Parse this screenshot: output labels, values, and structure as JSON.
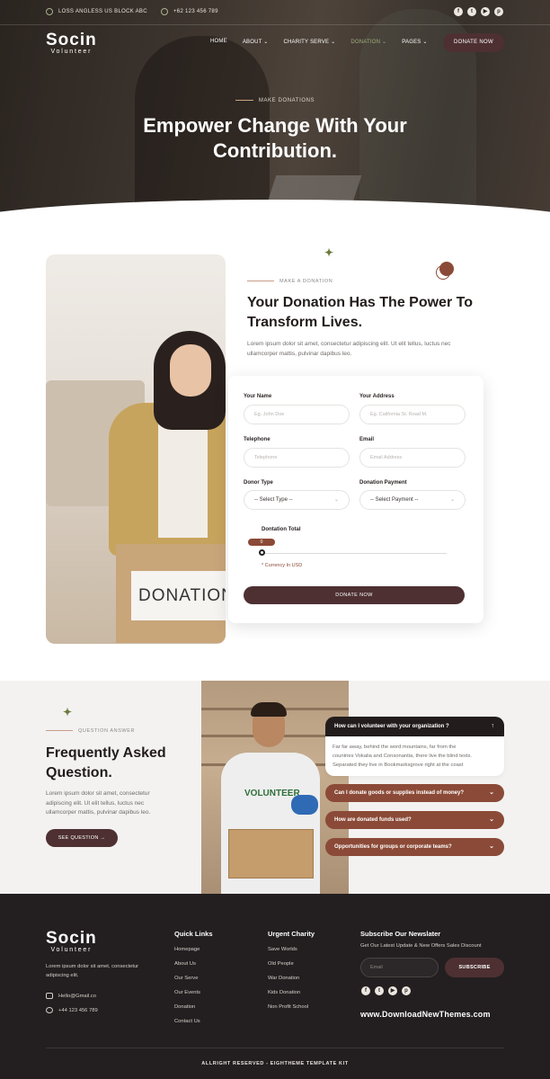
{
  "topbar": {
    "address": "LOSS ANGLESS US BLOCK ABC",
    "phone": "+62 123 456 789",
    "socials": [
      "facebook-icon",
      "twitter-icon",
      "youtube-icon",
      "pinterest-icon"
    ]
  },
  "brand": {
    "name": "Socin",
    "tagline": "Volunteer"
  },
  "nav": {
    "items": [
      "HOME",
      "ABOUT",
      "CHARITY SERVE",
      "DONATION",
      "PAGES"
    ],
    "active": "DONATION",
    "cta": "DONATE NOW"
  },
  "hero": {
    "eyebrow": "MAKE DONATIONS",
    "title_line1": "Empower Change With Your",
    "title_line2": "Contribution."
  },
  "donation": {
    "eyebrow": "MAKE A DONATION",
    "title_line1": "Your Donation Has The Power To",
    "title_line2": "Transform Lives.",
    "text_line1": "Lorem ipsum dolor sit amet, consectetur adipiscing elit. Ut elit tellus, luctus nec",
    "text_line2": "ullamcorper mattis, pulvinar dapibus leo.",
    "photo_label": "DONATION"
  },
  "form": {
    "name_label": "Your Name",
    "name_placeholder": "Eg. John Doe",
    "address_label": "Your Address",
    "address_placeholder": "Eg. California St. Road M.",
    "phone_label": "Telephone",
    "phone_placeholder": "Telephone",
    "email_label": "Email",
    "email_placeholder": "Email Address",
    "donor_label": "Donor Type",
    "donor_value": "-- Select Type --",
    "payment_label": "Donation Payment",
    "payment_value": "-- Select Payment --",
    "total_label": "Dontation Total",
    "total_value": "0",
    "currency": "* Currency In USD",
    "submit": "DONATE NOW"
  },
  "faq": {
    "eyebrow": "QUESTION ANSWER",
    "title_line1": "Frequently Asked",
    "title_line2": "Question.",
    "text_line1": "Lorem ipsum dolor sit amet, consectetur",
    "text_line2": "adipiscing elit. Ut elit tellus, luctus nec",
    "text_line3": "ullamcorper mattis, pulvinar dapibus leo.",
    "button": "SEE QUESTION",
    "photo_shirt": "VOLUNTEER",
    "open_question": "How can I volunteer with your organization ?",
    "open_answer_line1": "Far far away, behind the word mountains, far from the",
    "open_answer_line2": "countries Vokalia and Consonantia, there live the blind texts.",
    "open_answer_line3": "Separated they live in Bookmarksgrove right at the coast",
    "q2": "Can I donate goods or supplies instead of money?",
    "q3": "How are donated funds used?",
    "q4": "Opportunities for groups or corporate teams?",
    "colors": {
      "open": "#221c1d",
      "closed": "#8b4a37"
    }
  },
  "footer": {
    "about_line1": "Lorem ipsum dolor sit amet, consectetur",
    "about_line2": "adipiscing elit.",
    "email": "Hello@Gmail.co",
    "phone": "+44 123 456 789",
    "quick_links_title": "Quick Links",
    "quick_links": [
      "Homepage",
      "About Us",
      "Our Serve",
      "Our Events",
      "Donation",
      "Contact Us"
    ],
    "charity_title": "Urgent Charity",
    "charity_links": [
      "Save Worlds",
      "Old People",
      "War Donation",
      "Kids Donation",
      "Non Profit School"
    ],
    "newsletter_title": "Subscribe Our Newslater",
    "newsletter_text": "Get Our Latest Update & New Offers Sales Discount",
    "newsletter_placeholder": "Email",
    "newsletter_button": "SUBSCRIBE",
    "watermark": "www.DownloadNewThemes.com",
    "copyright": "ALLRIGHT RESERVED - EIGHTHEME TEMPLATE KIT"
  },
  "colors": {
    "primary": "#4e3032",
    "accent": "#8b4a37",
    "green": "#6c7a3c",
    "dark": "#231f20"
  }
}
